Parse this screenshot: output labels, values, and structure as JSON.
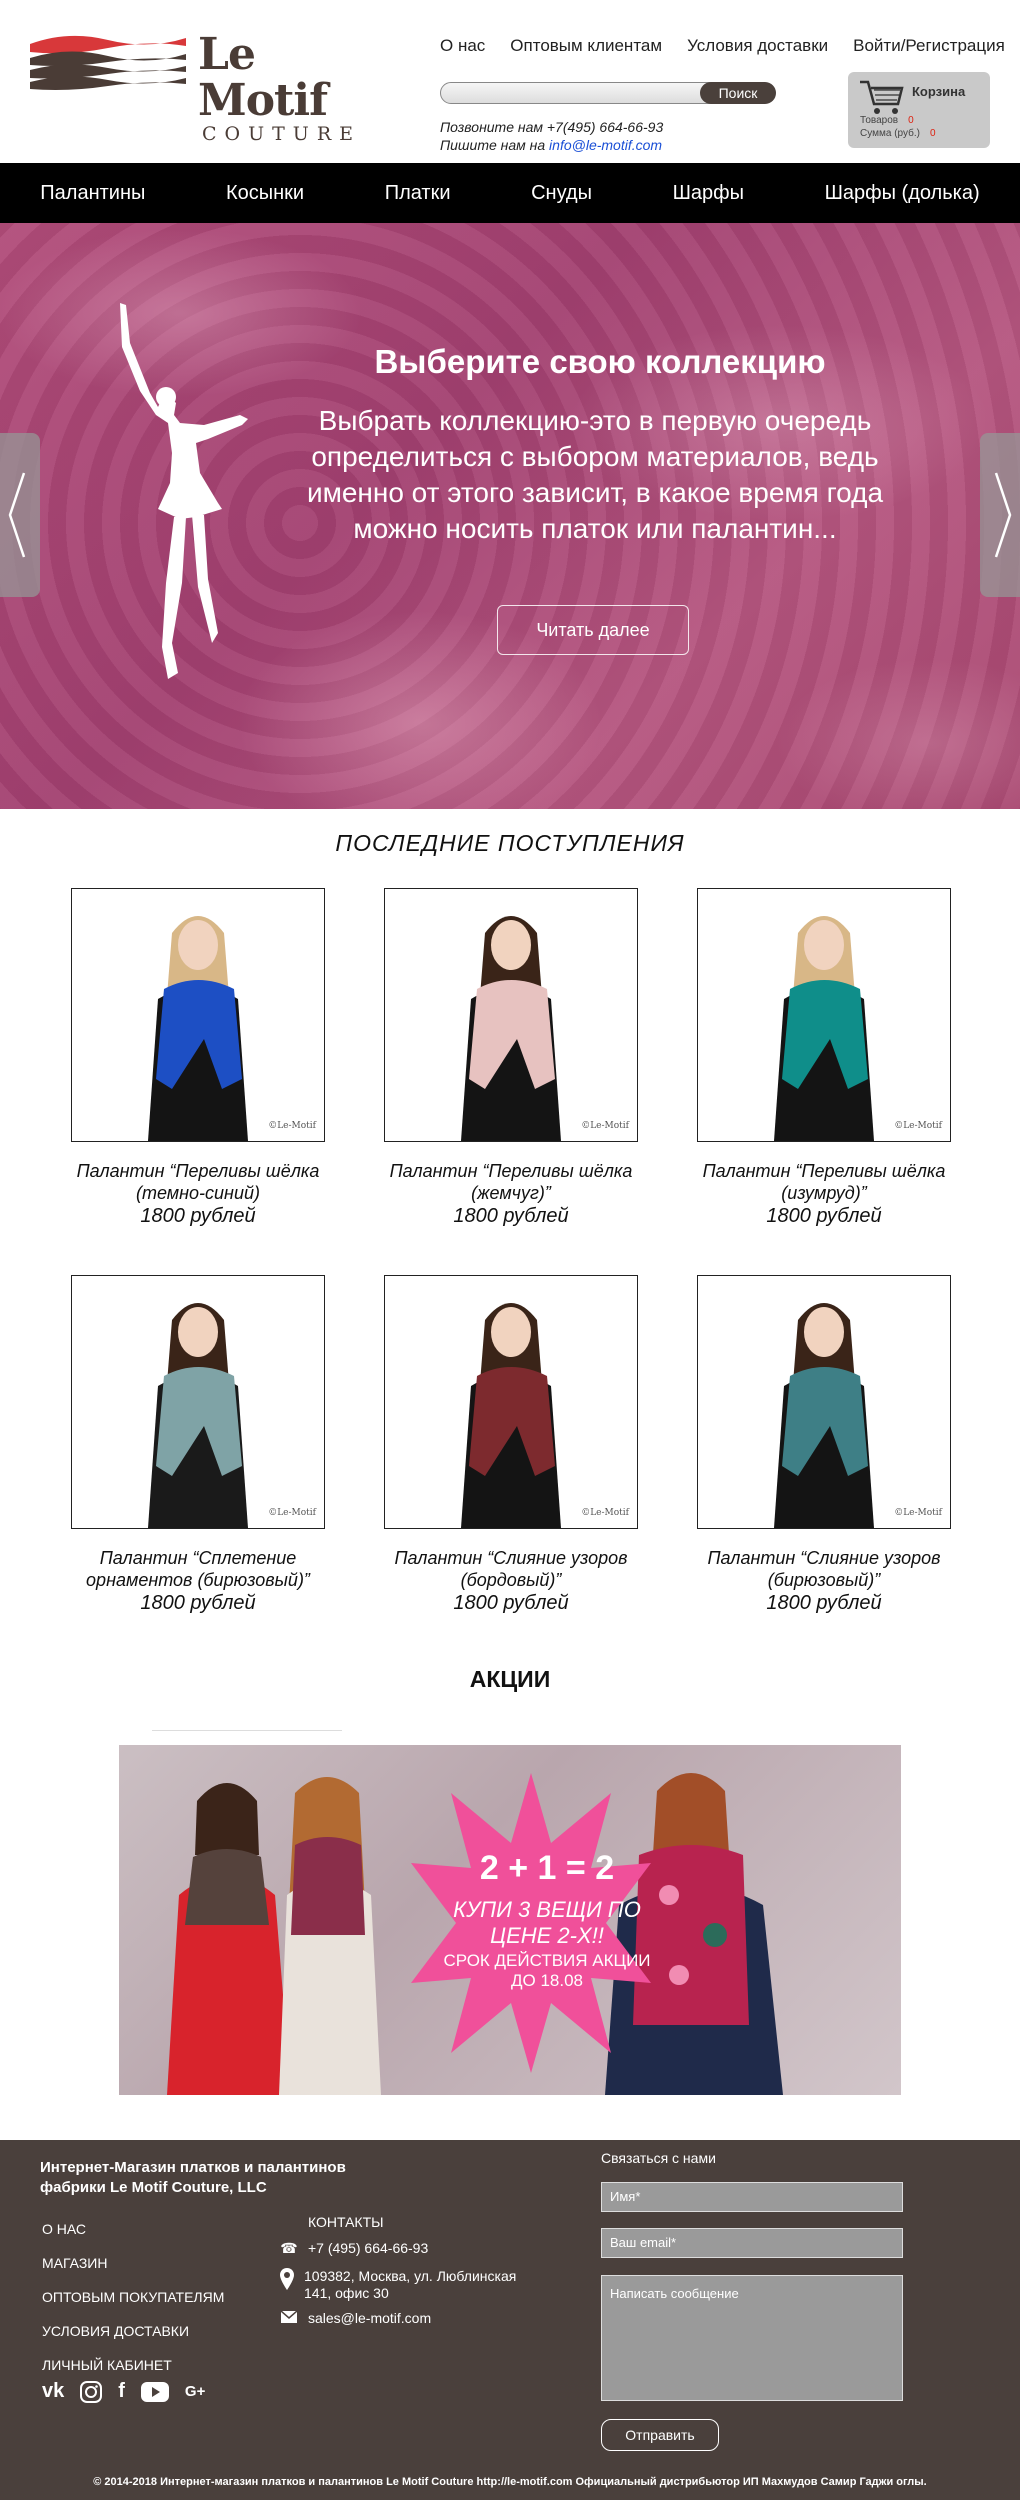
{
  "header": {
    "logo_main": "Le Motif",
    "logo_sub": "COUTURE",
    "topnav": [
      "О нас",
      "Оптовым клиентам",
      "Условия доставки",
      "Войти/Регистрация"
    ],
    "search": {
      "placeholder": "",
      "button": "Поиск"
    },
    "contacts": {
      "phone_line": "Позвоните нам +7(495) 664-66-93",
      "email_prefix": "Пишите нам на ",
      "email": "info@le-motif.com"
    },
    "cart": {
      "title": "Корзина",
      "items_label": "Товаров",
      "items_value": "0",
      "sum_label": "Сумма (руб.)",
      "sum_value": "0"
    }
  },
  "mainnav": [
    "Палантины",
    "Косынки",
    "Платки",
    "Снуды",
    "Шарфы",
    "Шарфы (долька)"
  ],
  "hero": {
    "title": "Выберите свою коллекцию",
    "text": "Выбрать коллекцию-это в первую очередь определиться с выбором материалов, ведь именно от этого зависит, в какое время года можно носить платок или палантин...",
    "button": "Читать далее"
  },
  "latest": {
    "title": "ПОСЛЕДНИЕ ПОСТУПЛЕНИЯ",
    "products": [
      {
        "name": "Палантин “Переливы шёлка (темно-синий)",
        "price": "1800 рублей",
        "scarf_color": "#1d4fc4",
        "watermark": "©Le-Motif"
      },
      {
        "name": "Палантин “Переливы шёлка (жемчуг)”",
        "price": "1800 рублей",
        "scarf_color": "#e7c2c0",
        "watermark": "©Le-Motif"
      },
      {
        "name": "Палантин “Переливы шёлка (изумруд)”",
        "price": "1800 рублей",
        "scarf_color": "#0f8e8a",
        "watermark": "©Le-Motif"
      },
      {
        "name": "Палантин “Сплетение орнаментов (бирюзовый)”",
        "price": "1800 рублей",
        "scarf_color": "#7fa3a6",
        "watermark": "©Le-Motif"
      },
      {
        "name": "Палантин “Слияние узоров (бордовый)”",
        "price": "1800 рублей",
        "scarf_color": "#7d2a2e",
        "watermark": "©Le-Motif"
      },
      {
        "name": "Палантин “Слияние узоров (бирюзовый)”",
        "price": "1800 рублей",
        "scarf_color": "#3e7f86",
        "watermark": "©Le-Motif"
      }
    ]
  },
  "promo": {
    "title": "АКЦИИ",
    "big": "2 + 1 = 2",
    "line2": "КУПИ 3 ВЕЩИ ПО ЦЕНЕ 2-Х!!",
    "line3": "СРОК ДЕЙСТВИЯ АКЦИИ ДО 18.08"
  },
  "footer": {
    "company": "Интернет-Магазин платков и палантинов фабрики Le Motif Couture, LLC",
    "links": [
      "О НАС",
      "МАГАЗИН",
      "ОПТОВЫМ ПОКУПАТЕЛЯМ",
      "УСЛОВИЯ ДОСТАВКИ",
      "ЛИЧНЫЙ КАБИНЕТ"
    ],
    "contacts_title": "КОНТАКТЫ",
    "phone": "+7 (495) 664-66-93",
    "address": "109382, Москва, ул. Люблинская 141, офис 30",
    "email": "sales@le-motif.com",
    "form_title": "Связаться с нами",
    "name_placeholder": "Имя*",
    "email_placeholder": "Ваш email*",
    "message_placeholder": "Написать сообщение",
    "send": "Отправить",
    "copyright": "© 2014-2018 Интернет-магазин платков и палантинов Le Motif Couture http://le-motif.com Официальный дистрибьютор ИП Махмудов Самир Гаджи оглы."
  },
  "colors": {
    "nav_bg": "#000000",
    "hero_bg": "#a8466f",
    "footer_bg": "#4a403c",
    "promo_burst": "#f0509a"
  }
}
